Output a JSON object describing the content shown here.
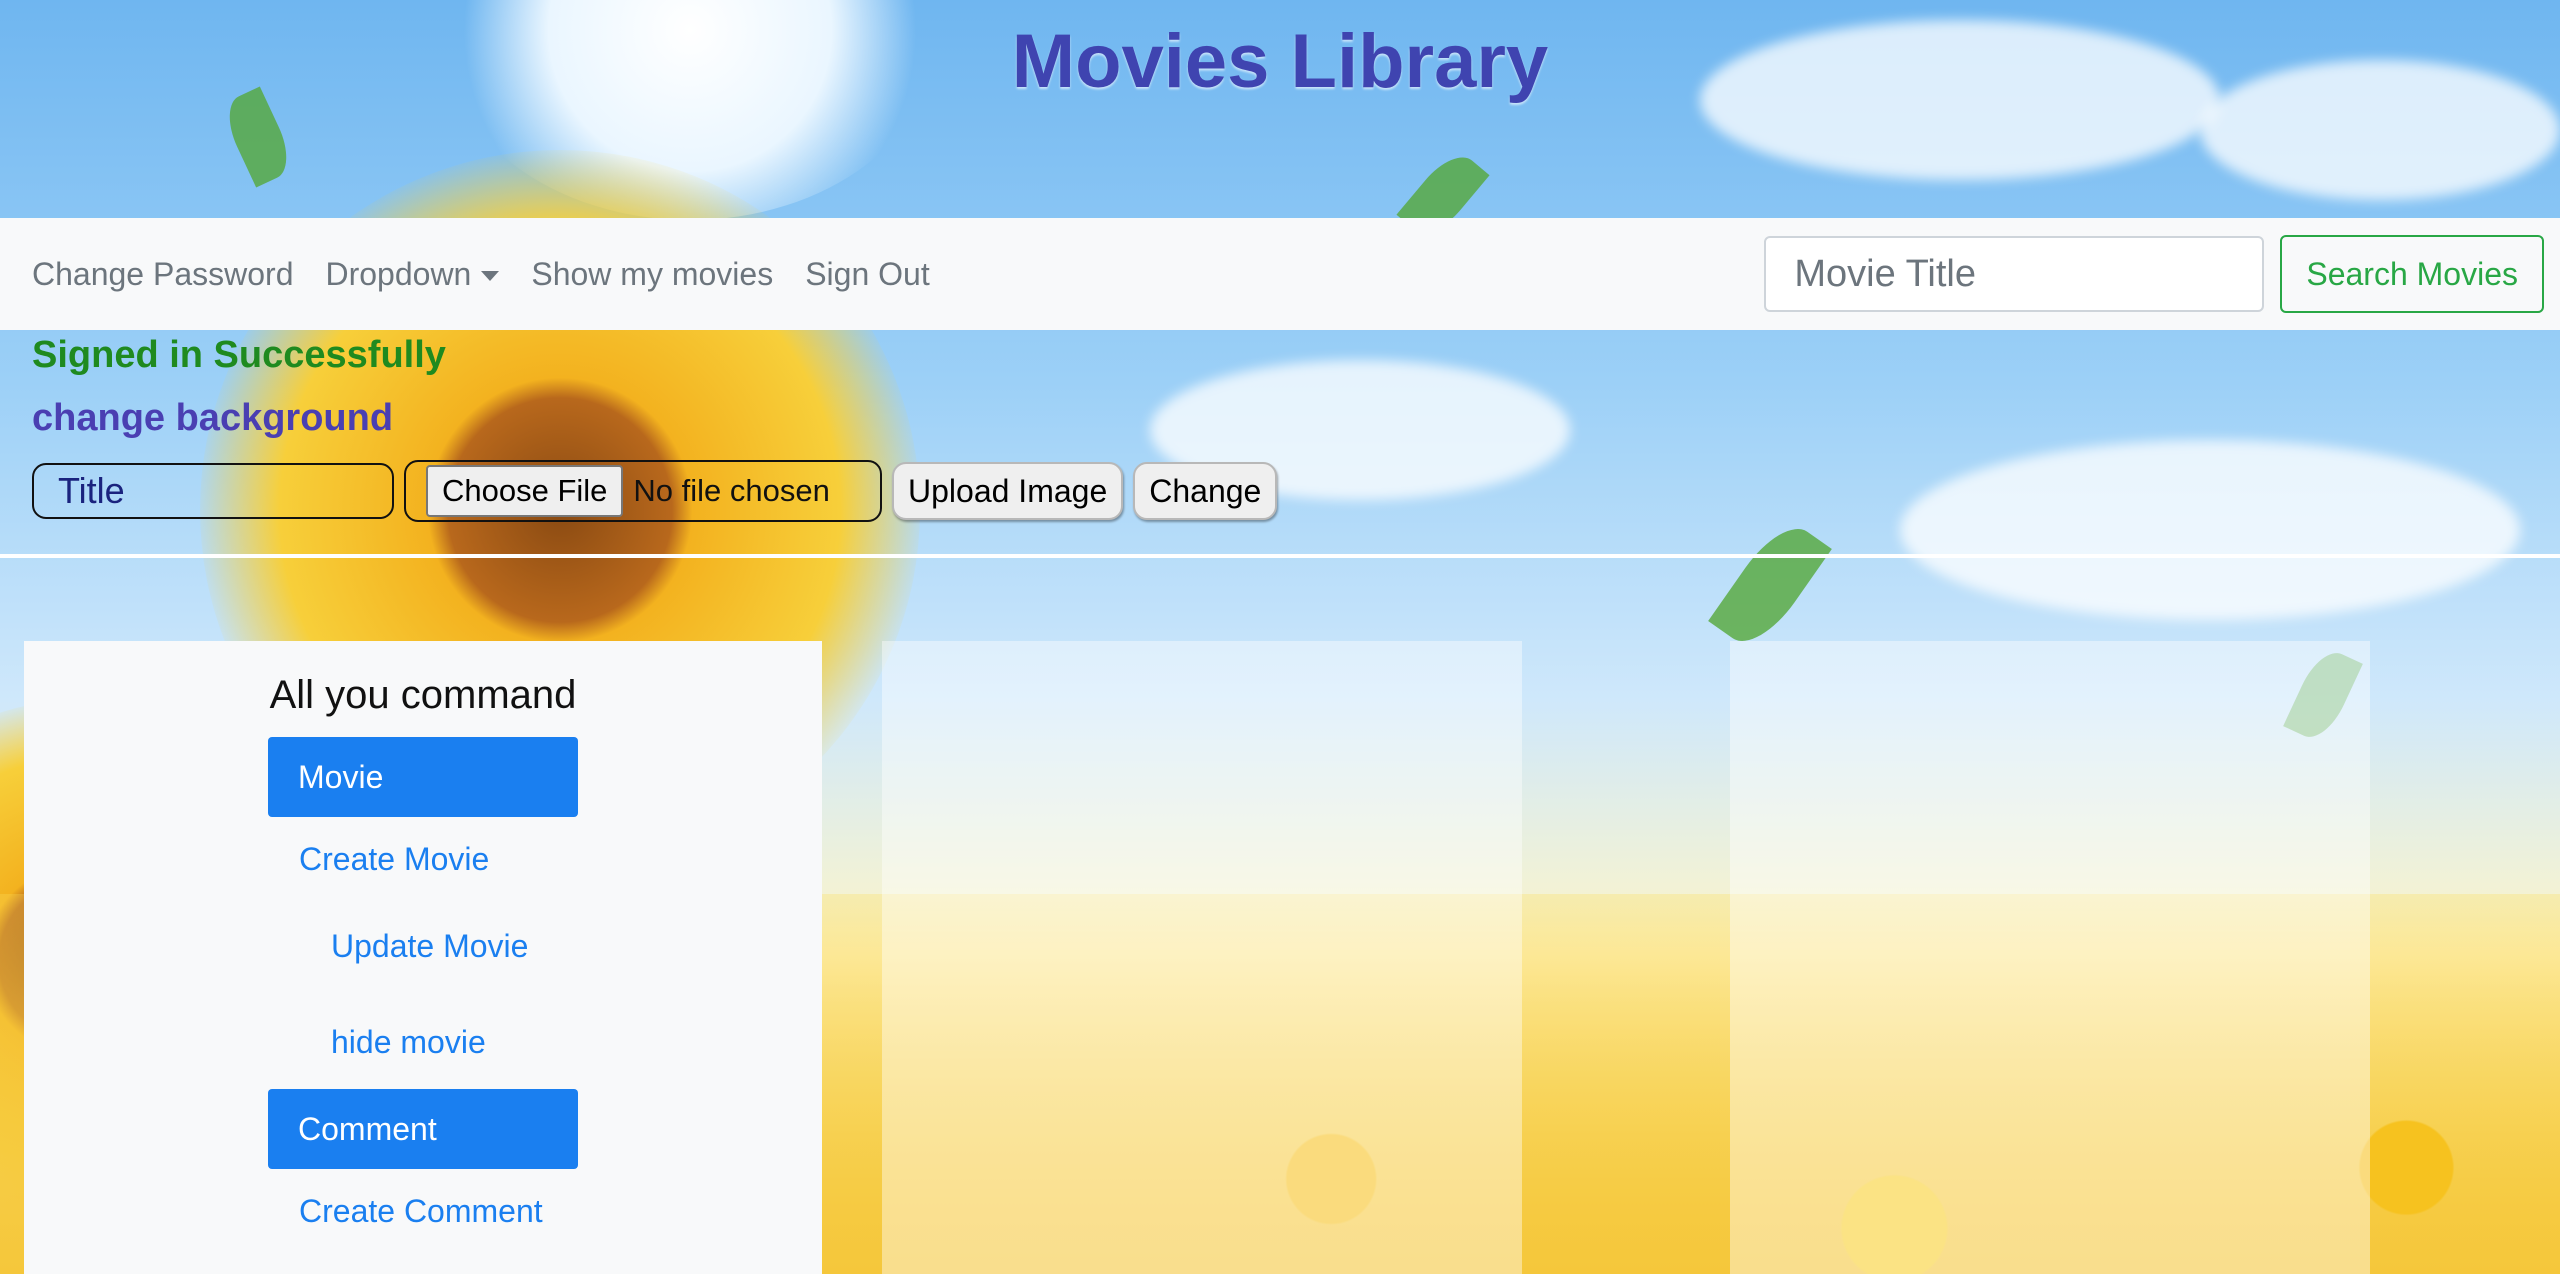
{
  "header": {
    "title": "Movies Library"
  },
  "navbar": {
    "links": [
      "Change Password",
      "Dropdown",
      "Show my movies",
      "Sign Out"
    ],
    "search": {
      "placeholder": "Movie Title",
      "value": "",
      "button_label": "Search Movies"
    }
  },
  "status": {
    "message": "Signed in Successfully",
    "message_color": "#1f8a1f"
  },
  "background": {
    "label": "change background",
    "title_placeholder": "Title",
    "choose_file_label": "Choose File",
    "no_file_text": "No file chosen",
    "upload_button": "Upload Image",
    "change_button": "Change"
  },
  "sidebar": {
    "heading": "All you command",
    "movie_button": "Movie",
    "create_movie": "Create Movie",
    "update_movie": "Update Movie",
    "hide_movie": "hide movie",
    "comment_button": "Comment",
    "create_comment": "Create Comment"
  },
  "colors": {
    "title": "#3f44b0",
    "primary": "#1a7ff0",
    "success": "#28a745",
    "label_purple": "#4a3fb2"
  }
}
